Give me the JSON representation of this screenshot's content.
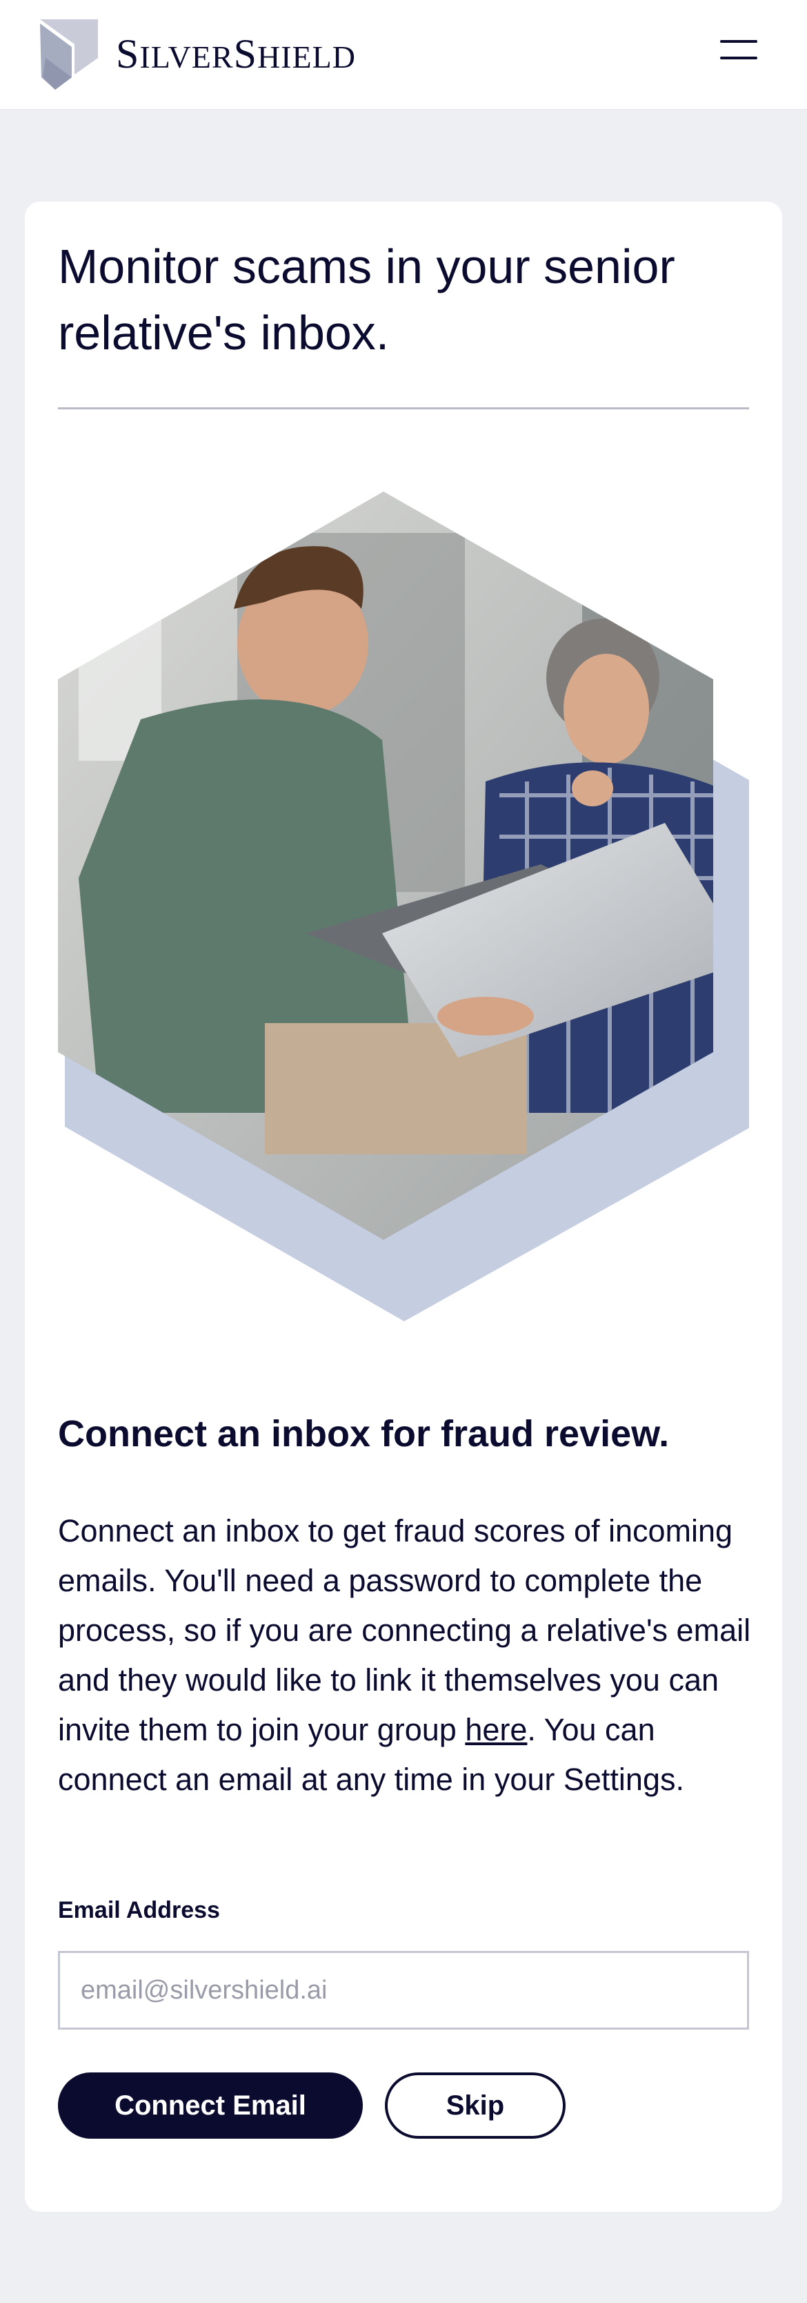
{
  "header": {
    "brand": {
      "part1_cap": "S",
      "part1_rest": "ILVER",
      "part2_cap": "S",
      "part2_rest": "HIELD"
    },
    "menu_icon": "hamburger-menu-icon",
    "logo_icon": "shield-icon"
  },
  "main": {
    "headline": "Monitor scams in your senior relative's inbox.",
    "hero_image": "photo-man-and-senior-woman-looking-at-laptop",
    "subtitle": "Connect an inbox for fraud review.",
    "body": {
      "before_link": "Connect an inbox to get fraud scores of incoming emails. You'll need a password to complete the process, so if you are connecting a relative's email and they would like to link it themselves you can invite them to join your group ",
      "link_text": "here",
      "after_link": ". You can connect an email at any time in your Settings."
    },
    "email_label": "Email Address",
    "email_placeholder": "email@silvershield.ai",
    "email_value": "",
    "connect_button": "Connect Email",
    "skip_button": "Skip"
  },
  "colors": {
    "navy": "#0b0b30",
    "page_background": "#eeeff3",
    "hex_accent": "#c5cde1",
    "divider": "#b9bcc6"
  }
}
